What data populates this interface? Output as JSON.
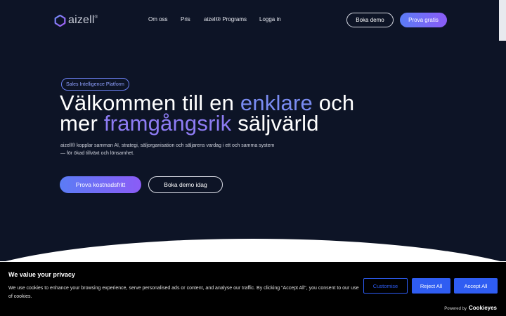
{
  "header": {
    "logo_text": "aizell",
    "logo_mark": "®",
    "nav": [
      "Om oss",
      "Pris",
      "aizell® Programs",
      "Logga in"
    ],
    "btn_demo": "Boka demo",
    "btn_gratis": "Prova gratis"
  },
  "hero": {
    "badge": "Sales Intelligence Platform",
    "headline": {
      "part1": "Välkommen till en ",
      "accent1": "enklare",
      "part2": " och",
      "part3": "mer ",
      "accent2": "framgångsrik",
      "part4": " säljvärld"
    },
    "lead_line1": "aizell® kopplar samman AI, strategi, säljorganisation och säljarens vardag i ett och samma system",
    "lead_line2": "— för ökad tillväxt och lönsamhet.",
    "cta_primary": "Prova kostnadsfritt",
    "cta_secondary": "Boka demo idag"
  },
  "cookie": {
    "title": "We value your privacy",
    "text": "We use cookies to enhance your browsing experience, serve personalised ads or content, and analyse our traffic. By clicking \"Accept All\", you consent to our use of cookies.",
    "btn_customise": "Customise",
    "btn_reject": "Reject All",
    "btn_accept": "Accept All",
    "powered_by": "Powered by",
    "powered_brand": "Cookieyes"
  },
  "colors": {
    "hero_bg": "#0d1426",
    "accent_blue": "#5b7cf5",
    "accent_purple": "#8b5cf6",
    "cookie_button": "#2f5df2"
  }
}
